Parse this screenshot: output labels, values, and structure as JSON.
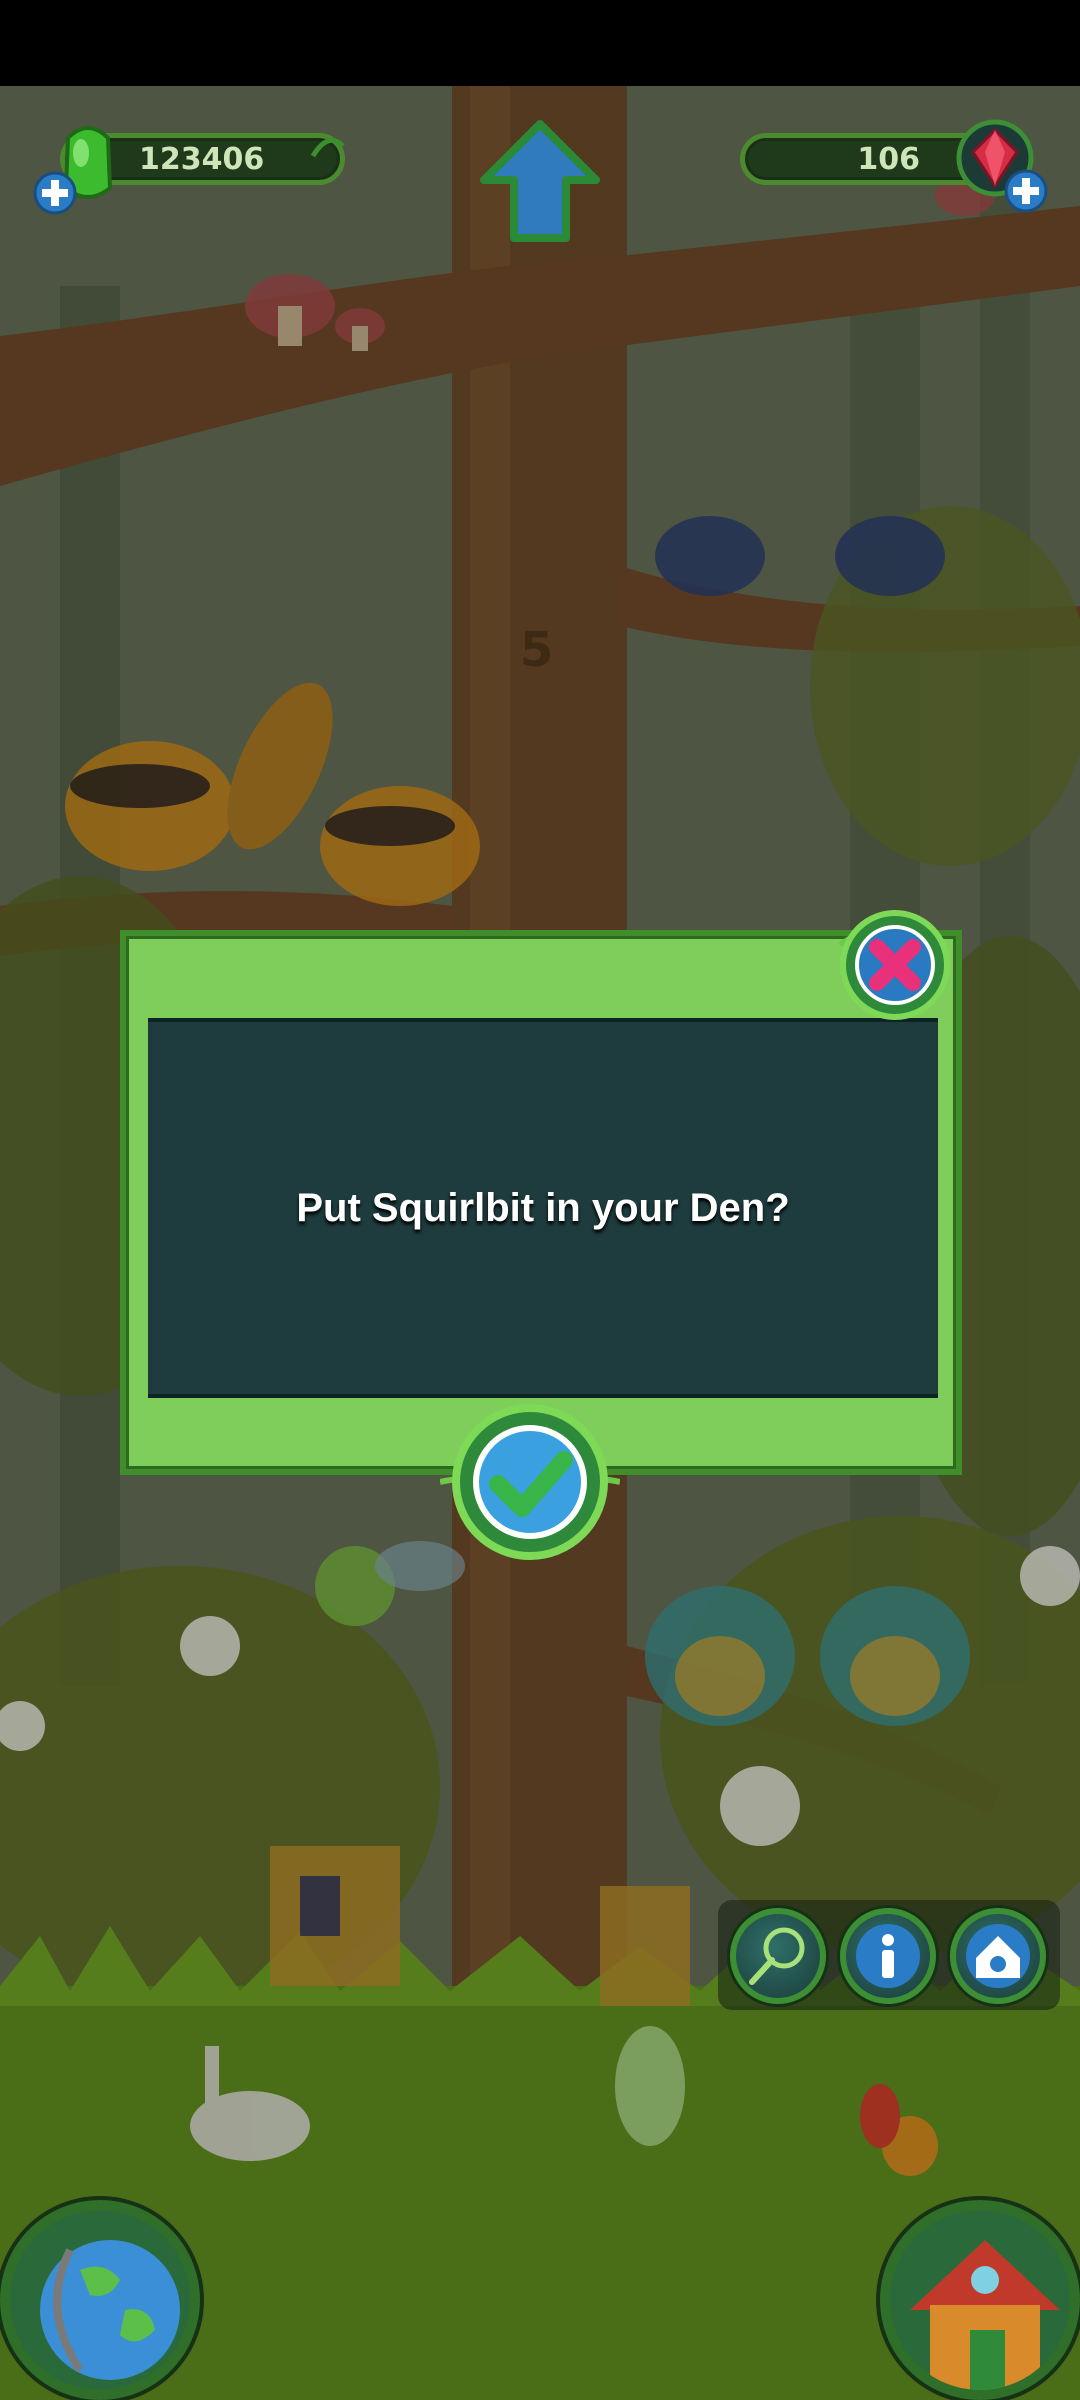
{
  "hud": {
    "green_currency_value": "123406",
    "gem_currency_value": "106"
  },
  "dialog": {
    "message": "Put Squirlbit in your Den?"
  },
  "icons": {
    "green_potion": "green-potion-icon",
    "red_gem": "red-gem-icon",
    "add": "plus-icon",
    "home_up": "up-arrow-icon",
    "close": "close-icon",
    "confirm": "checkmark-icon",
    "net": "net-icon",
    "info": "info-icon",
    "den": "den-icon",
    "globe": "globe-icon",
    "house": "house-icon"
  },
  "colors": {
    "dialog_bg": "#7fce5b",
    "dialog_inner": "#1e3b3d",
    "close_x": "#e8317a",
    "confirm_check": "#39b54a"
  }
}
